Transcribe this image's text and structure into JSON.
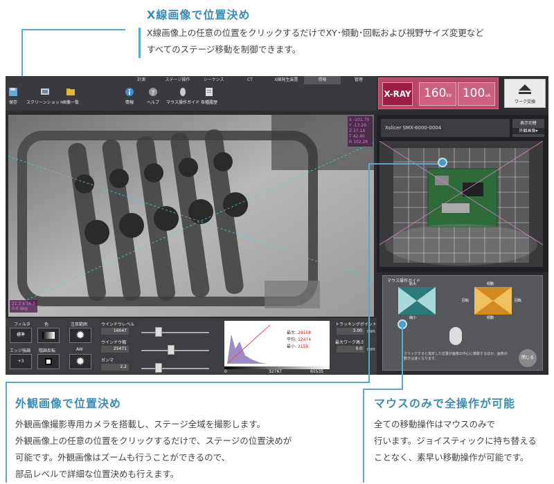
{
  "callouts": {
    "top": {
      "title": "X線画像で位置決め",
      "text1": "X線画像上の任意の位置をクリックするだけでXY･傾動･回転および視野サイズ変更など",
      "text2": "すべてのステージ移動を制御できます。"
    },
    "bottom_left": {
      "title": "外観画像で位置決め",
      "lines": [
        "外観画像撮影専用カメラを搭載し、ステージ全域を撮影します。",
        "外観画像上の任意の位置をクリックするだけで、ステージの位置決めが",
        "可能です。外観画像はズームも行うことができるので、",
        "部品レベルで詳細な位置決めも行えます。"
      ]
    },
    "bottom_right": {
      "title": "マウスのみで全操作が可能",
      "lines": [
        "全ての移動操作はマウスのみで",
        "行います。ジョイスティックに持ち替える",
        "ことなく、素早い移動操作が可能です。"
      ]
    }
  },
  "app": {
    "tabs": [
      "計測",
      "ステージ操作",
      "シーケンス",
      "CT",
      "X線発生装置",
      "情報",
      "管理"
    ],
    "active_tab": 5,
    "tools_left": [
      "保存",
      "スクリーンショット",
      "画像一覧"
    ],
    "tools_right": [
      "情報",
      "ヘルプ",
      "マウス操作ガイド",
      "各種履歴"
    ],
    "xray_label": "X-RAY",
    "kv_value": "160",
    "kv_unit": "kV",
    "ua_value": "100",
    "ua_unit": "uA",
    "exchange_label": "ワーク交換",
    "coords": [
      "X -101.70",
      "Y -13.29",
      "Z 37.14",
      "T 42.40",
      "R 102.28"
    ],
    "scale_lines": [
      "21.2 x 16.5",
      "0.0 deg"
    ],
    "model_name": "Xslicer SMX-6000-0004",
    "display_switch": "表示切替",
    "display_mode": "外観画像▾",
    "mouse_guide": {
      "title": "マウス操作ガイド",
      "zoom_in": "拡大",
      "zoom_out": "縮小",
      "tilt_up": "傾動",
      "tilt_down": "傾動",
      "rotate_l": "回転",
      "rotate_r": "回転",
      "note": "クリックすると指定した位置が画像の中心に移動するほか、画像の動きは速くなります。",
      "close": "閉じる"
    },
    "controls": {
      "filter": "フィルタ",
      "filter_val": "標準",
      "color": "色",
      "edge": "エッジ強調",
      "edge_val": "+3",
      "invert": "階調反転",
      "range": "注目範囲",
      "aw": "AW",
      "window_level": "ウインドウレベル",
      "window_level_val": "16047",
      "window_width": "ウインドウ幅",
      "window_width_val": "25471",
      "gamma": "ガンマ",
      "gamma_val": "2.2",
      "hist_max": "最大:",
      "hist_max_val": "29158",
      "hist_avg": "平均:",
      "hist_avg_val": "12474",
      "hist_min": "最小:",
      "hist_min_val": "2159",
      "axis": [
        "0",
        "32767",
        "65535"
      ],
      "tracking": "トラッキングポイント",
      "tracking_val": "3.00",
      "max_height": "最大ワーク高さ",
      "max_height_val": "0.0",
      "unit": "mm"
    }
  }
}
